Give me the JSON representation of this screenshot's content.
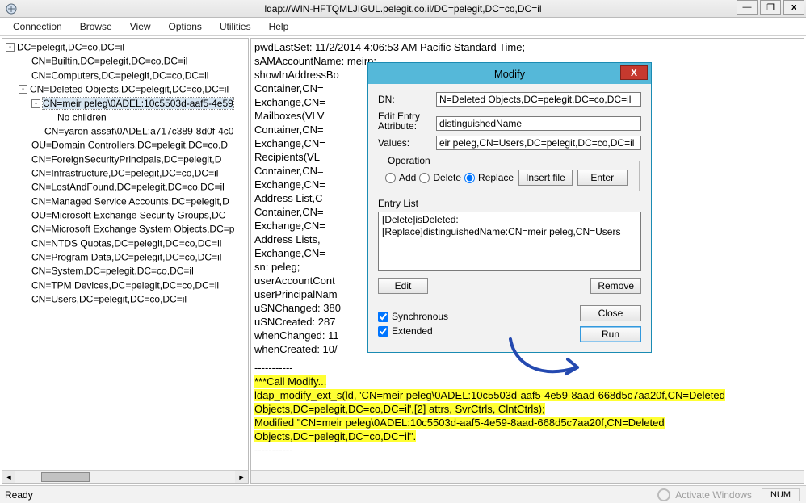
{
  "window": {
    "title": "ldap://WIN-HFTQMLJIGUL.pelegit.co.il/DC=pelegit,DC=co,DC=il",
    "minimize_glyph": "—",
    "restore_glyph": "❐",
    "close_glyph": "x"
  },
  "menu": {
    "items": [
      "Connection",
      "Browse",
      "View",
      "Options",
      "Utilities",
      "Help"
    ]
  },
  "tree": {
    "nodes": [
      {
        "indent": 0,
        "toggle": "-",
        "label": "DC=pelegit,DC=co,DC=il"
      },
      {
        "indent": 1,
        "toggle": "",
        "label": "CN=Builtin,DC=pelegit,DC=co,DC=il"
      },
      {
        "indent": 1,
        "toggle": "",
        "label": "CN=Computers,DC=pelegit,DC=co,DC=il"
      },
      {
        "indent": 1,
        "toggle": "-",
        "label": "CN=Deleted Objects,DC=pelegit,DC=co,DC=il"
      },
      {
        "indent": 2,
        "toggle": "-",
        "label": "CN=meir peleg\\0ADEL:10c5503d-aaf5-4e59",
        "selected": true
      },
      {
        "indent": 3,
        "toggle": "",
        "label": "No children"
      },
      {
        "indent": 2,
        "toggle": "",
        "label": "CN=yaron assaf\\0ADEL:a717c389-8d0f-4c0"
      },
      {
        "indent": 1,
        "toggle": "",
        "label": "OU=Domain Controllers,DC=pelegit,DC=co,D"
      },
      {
        "indent": 1,
        "toggle": "",
        "label": "CN=ForeignSecurityPrincipals,DC=pelegit,D"
      },
      {
        "indent": 1,
        "toggle": "",
        "label": "CN=Infrastructure,DC=pelegit,DC=co,DC=il"
      },
      {
        "indent": 1,
        "toggle": "",
        "label": "CN=LostAndFound,DC=pelegit,DC=co,DC=il"
      },
      {
        "indent": 1,
        "toggle": "",
        "label": "CN=Managed Service Accounts,DC=pelegit,D"
      },
      {
        "indent": 1,
        "toggle": "",
        "label": "OU=Microsoft Exchange Security Groups,DC"
      },
      {
        "indent": 1,
        "toggle": "",
        "label": "CN=Microsoft Exchange System Objects,DC=p"
      },
      {
        "indent": 1,
        "toggle": "",
        "label": "CN=NTDS Quotas,DC=pelegit,DC=co,DC=il"
      },
      {
        "indent": 1,
        "toggle": "",
        "label": "CN=Program Data,DC=pelegit,DC=co,DC=il"
      },
      {
        "indent": 1,
        "toggle": "",
        "label": "CN=System,DC=pelegit,DC=co,DC=il"
      },
      {
        "indent": 1,
        "toggle": "",
        "label": "CN=TPM Devices,DC=pelegit,DC=co,DC=il"
      },
      {
        "indent": 1,
        "toggle": "",
        "label": "CN=Users,DC=pelegit,DC=co,DC=il"
      }
    ]
  },
  "detail": {
    "lines": [
      "pwdLastSet: 11/2/2014 4:06:53 AM Pacific Standard Time;",
      "sAMAccountName: meirp;",
      "showInAddressBo                                                                     sts,CN=Address Lists",
      "Container,CN=                                                                        ",
      "Exchange,CN=                                                                        ,CN=All",
      "Mailboxes(VLV                                                                        ",
      "Container,CN=                                                                        ",
      "Exchange,CN=                                                                        ,CN=All",
      "Recipients(VL                                                                        ",
      "Container,CN=                                                                        ",
      "Exchange,CN=                                                                        ,CN=Default Global",
      "Address List,C                                                                        ",
      "Container,CN=                                                                        ",
      "Exchange,CN=                                                                        ,CN=All Users,CN=All",
      "Address Lists,                                                                        ",
      "Exchange,CN=                                                                        ",
      "sn: peleg;",
      "userAccountCont",
      "userPrincipalNam",
      "uSNChanged: 380",
      "uSNCreated: 287",
      "whenChanged: 11",
      "whenCreated: 10/"
    ],
    "sep": "-----------",
    "log": [
      "***Call Modify...",
      "ldap_modify_ext_s(ld, 'CN=meir peleg\\0ADEL:10c5503d-aaf5-4e59-8aad-668d5c7aa20f,CN=Deleted",
      "Objects,DC=pelegit,DC=co,DC=il',[2] attrs, SvrCtrls, ClntCtrls);",
      "Modified \"CN=meir peleg\\0ADEL:10c5503d-aaf5-4e59-8aad-668d5c7aa20f,CN=Deleted",
      "Objects,DC=pelegit,DC=co,DC=il\"."
    ]
  },
  "modal": {
    "title": "Modify",
    "dn_label": "DN:",
    "dn_value": "N=Deleted Objects,DC=pelegit,DC=co,DC=il",
    "edit_entry_attr_label": "Edit Entry\nAttribute:",
    "attr_value": "distinguishedName",
    "values_label": "Values:",
    "values_value": "eir peleg,CN=Users,DC=pelegit,DC=co,DC=il",
    "operation_legend": "Operation",
    "op_add": "Add",
    "op_delete": "Delete",
    "op_replace": "Replace",
    "insert_file_btn": "Insert file",
    "enter_btn": "Enter",
    "entry_list_label": "Entry List",
    "entries": [
      "[Delete]isDeleted:",
      "[Replace]distinguishedName:CN=meir peleg,CN=Users"
    ],
    "edit_btn": "Edit",
    "remove_btn": "Remove",
    "synchronous_label": "Synchronous",
    "extended_label": "Extended",
    "close_btn": "Close",
    "run_btn": "Run"
  },
  "status": {
    "ready": "Ready",
    "activate": "Activate Windows",
    "num": "NUM"
  }
}
